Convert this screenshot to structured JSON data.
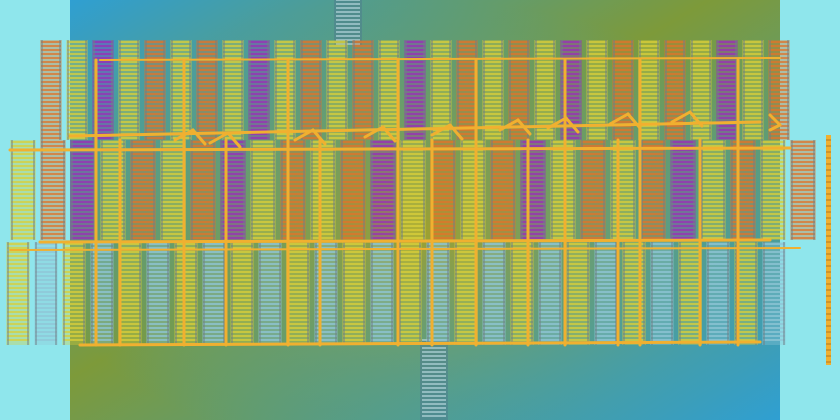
{
  "scene": {
    "kind": "top-down render of a large redstone-style circuit build",
    "sky_color": "#8fe6ec",
    "ground_colors": [
      "#2f9fd2",
      "#6e9a3a",
      "#8aa02a"
    ],
    "palette": {
      "wire": "#f0b030",
      "yellow_block": "#d9cf3a",
      "orange_block": "#e0742a",
      "purple_block": "#9a2fb8",
      "blue_block": "#8fc6d6"
    },
    "sections": [
      {
        "label": "top-array",
        "pattern": [
          "orange",
          "yellow",
          "purple",
          "yellow",
          "orange",
          "yellow"
        ]
      },
      {
        "label": "middle-array",
        "pattern": [
          "yellow",
          "orange",
          "purple",
          "yellow",
          "orange"
        ]
      },
      {
        "label": "bottom-array",
        "pattern": [
          "yellow",
          "blue",
          "yellow",
          "blue"
        ]
      }
    ],
    "has_north_tower": true,
    "has_south_tower": true
  }
}
